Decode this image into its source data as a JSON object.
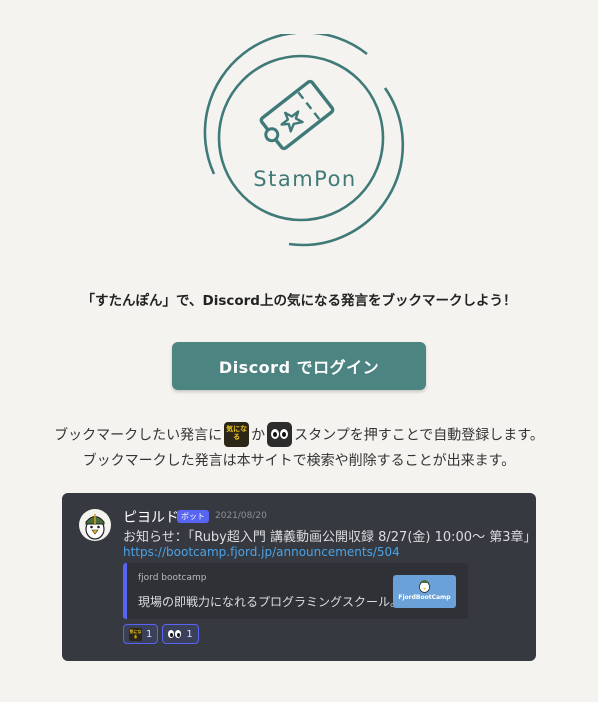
{
  "logo": {
    "text": "StamPon"
  },
  "tagline": "「すたんぽん」で、Discord上の気になる発言をブックマークしよう！",
  "login_button": {
    "label": "Discord でログイン"
  },
  "description": {
    "line1_before": "ブックマークしたい発言に",
    "line1_or": "か",
    "line1_after": "スタンプを押すことで自動登録します。",
    "line2": "ブックマークした発言は本サイトで検索や削除することが出来ます。",
    "stamp_kiniro_text": "気になる"
  },
  "discord_example": {
    "username": "ピヨルド",
    "bot_badge": "ボット",
    "timestamp": "2021/08/20",
    "message": "お知らせ：「Ruby超入門 講義動画公開収録 8/27(金) 10:00〜 第3章」",
    "link": "https://bootcamp.fjord.jp/announcements/504",
    "embed": {
      "provider": "fjord bootcamp",
      "description": "現場の即戦力になれるプログラミングスクール。",
      "thumbnail_text": "FjordBootCamp"
    },
    "reactions": [
      {
        "icon": "kiniro-stamp-icon",
        "count": "1"
      },
      {
        "icon": "eyes-icon",
        "count": "1"
      }
    ]
  },
  "colors": {
    "background": "#f4f3ef",
    "brand": "#3f7a78",
    "button": "#4b8480",
    "discord_bg": "#36393f",
    "discord_embed": "#2f3136",
    "blurple": "#5865f2",
    "link": "#4aa3e8"
  }
}
